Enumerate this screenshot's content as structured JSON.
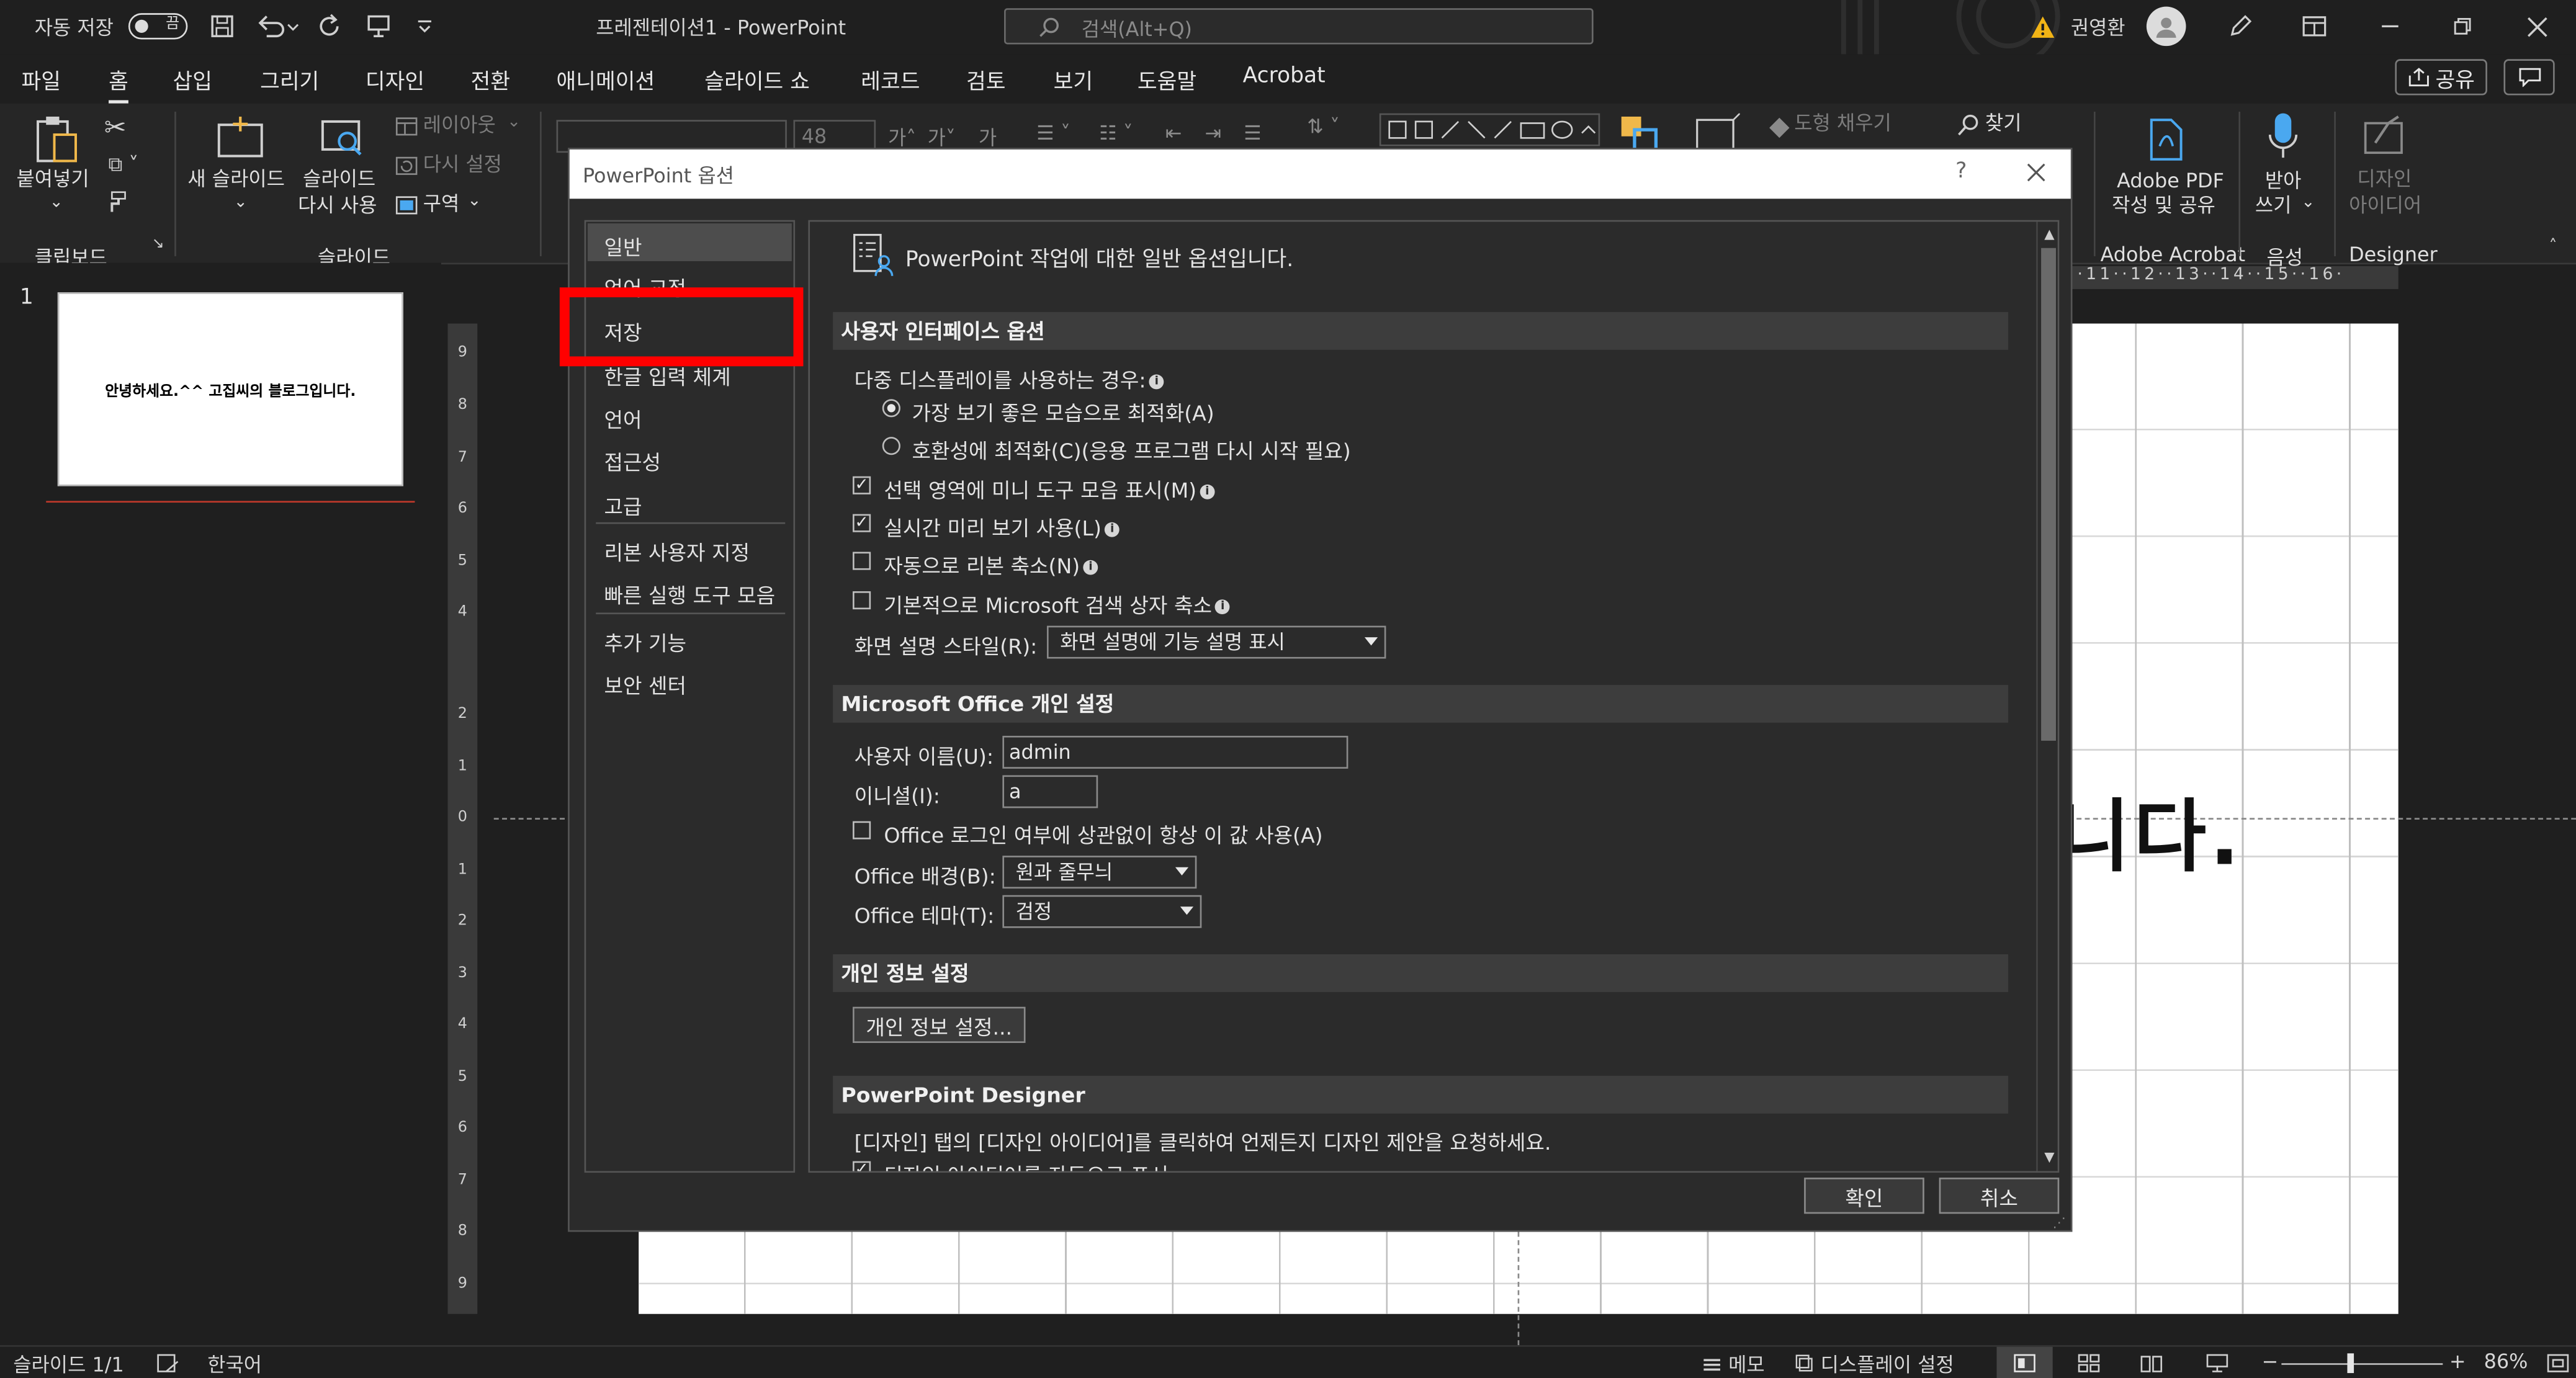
{
  "titlebar": {
    "autosave_label": "자동 저장",
    "autosave_state": "끔",
    "doc_title": "프레젠테이션1  -  PowerPoint",
    "search_placeholder": "검색(Alt+Q)",
    "user_name": "권영환"
  },
  "tabs": [
    "파일",
    "홈",
    "삽입",
    "그리기",
    "디자인",
    "전환",
    "애니메이션",
    "슬라이드 쇼",
    "레코드",
    "검토",
    "보기",
    "도움말",
    "Acrobat"
  ],
  "share_label": "공유",
  "ribbon": {
    "paste": "붙여넣기",
    "clipboard_group": "클립보드",
    "new_slide": "새 슬라이드",
    "reuse_slide_1": "슬라이드",
    "reuse_slide_2": "다시 사용",
    "layout": "레이아웃",
    "reset": "다시 설정",
    "section": "구역",
    "slides_group": "슬라이드",
    "font_size": "48",
    "shape_fill": "도형 채우기",
    "find": "찾기",
    "adobe_1": "Adobe PDF",
    "adobe_2": "작성 및 공유",
    "adobe_group": "Adobe Acrobat",
    "dictate_1": "받아",
    "dictate_2": "쓰기",
    "voice_group": "음성",
    "designer_1": "디자인",
    "designer_2": "아이디어",
    "designer_group": "Designer"
  },
  "thumbnail": {
    "number": "1",
    "text": "안녕하세요.^^ 고집씨의 블로그입니다."
  },
  "slide_text": "니다.",
  "hruler_text": "·11··12··13··14··15··16·",
  "dialog": {
    "title": "PowerPoint 옵션",
    "help": "?",
    "nav": [
      "일반",
      "언어 교정",
      "저장",
      "한글 입력 체계",
      "언어",
      "접근성",
      "고급",
      "리본 사용자 지정",
      "빠른 실행 도구 모음",
      "추가 기능",
      "보안 센터"
    ],
    "header": "PowerPoint 작업에 대한 일반 옵션입니다.",
    "sec_ui": "사용자 인터페이스 옵션",
    "multi_display": "다중 디스플레이를 사용하는 경우:",
    "opt_best": "가장 보기 좋은 모습으로 최적화(A)",
    "opt_compat": "호환성에 최적화(C)(응용 프로그램 다시 시작 필요)",
    "mini_toolbar": "선택 영역에 미니 도구 모음 표시(M)",
    "live_preview": "실시간 미리 보기 사용(L)",
    "collapse_ribbon": "자동으로 리본 축소(N)",
    "collapse_search": "기본적으로 Microsoft 검색 상자 축소",
    "screentip_label": "화면 설명 스타일(R):",
    "screentip_value": "화면 설명에 기능 설명 표시",
    "sec_office": "Microsoft Office 개인 설정",
    "username_label": "사용자 이름(U):",
    "username_value": "admin",
    "initials_label": "이니셜(I):",
    "initials_value": "a",
    "always_use": "Office 로그인 여부에 상관없이 항상 이 값 사용(A)",
    "bg_label": "Office 배경(B):",
    "bg_value": "원과 줄무늬",
    "theme_label": "Office 테마(T):",
    "theme_value": "검정",
    "sec_privacy": "개인 정보 설정",
    "privacy_btn": "개인 정보 설정...",
    "sec_designer": "PowerPoint Designer",
    "designer_text": "[디자인] 탭의 [디자인 아이디어]를 클릭하여 언제든지 디자인 제안을 요청하세요.",
    "designer_auto": "디자인 아이디어를 자동으로 표시",
    "ok": "확인",
    "cancel": "취소"
  },
  "status": {
    "slide": "슬라이드 1/1",
    "lang": "한국어",
    "notes": "메모",
    "display": "디스플레이 설정",
    "zoom": "86%"
  },
  "colors": {
    "highlight": "#ff0000",
    "dialog_bg": "#2b2b2b",
    "app_bg": "#1f1f1f"
  }
}
